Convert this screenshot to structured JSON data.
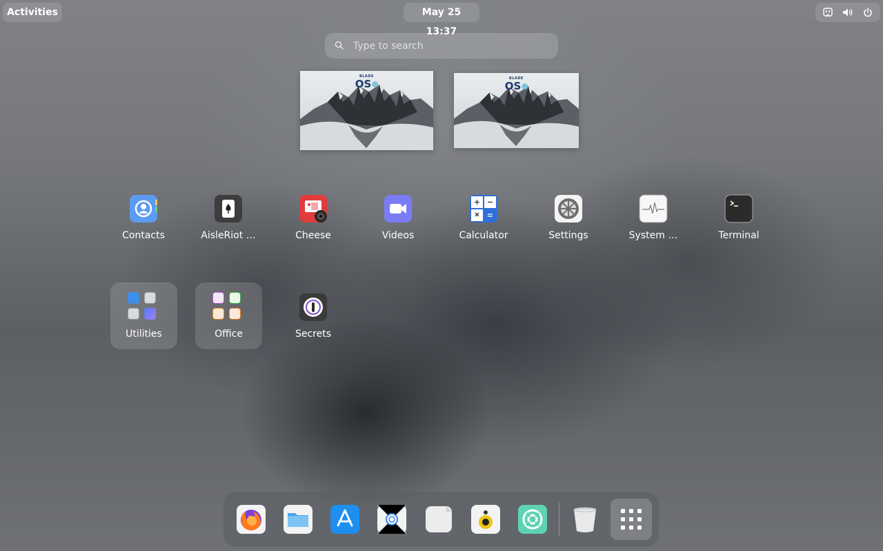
{
  "topbar": {
    "activities_label": "Activities",
    "date": "May 25",
    "time": "13:37",
    "tray_icons": [
      "accessibility-icon",
      "volume-icon",
      "power-icon"
    ]
  },
  "search": {
    "placeholder": "Type to search"
  },
  "workspaces": [
    {
      "logo_small": "BLADE",
      "logo_big": "OS"
    },
    {
      "logo_small": "BLADE",
      "logo_big": "OS"
    }
  ],
  "apps": [
    {
      "label": "Contacts",
      "icon": "contacts-icon"
    },
    {
      "label": "AisleRiot …",
      "icon": "aisleriot-icon"
    },
    {
      "label": "Cheese",
      "icon": "cheese-icon"
    },
    {
      "label": "Videos",
      "icon": "videos-icon"
    },
    {
      "label": "Calculator",
      "icon": "calculator-icon"
    },
    {
      "label": "Settings",
      "icon": "settings-icon"
    },
    {
      "label": "System …",
      "icon": "system-monitor-icon"
    },
    {
      "label": "Terminal",
      "icon": "terminal-icon"
    },
    {
      "label": "Utilities",
      "icon": "utilities-folder-icon"
    },
    {
      "label": "Office",
      "icon": "office-folder-icon"
    },
    {
      "label": "Secrets",
      "icon": "secrets-icon"
    }
  ],
  "dock": {
    "items": [
      "firefox-icon",
      "files-icon",
      "app-store-icon",
      "browser-icon",
      "text-editor-icon",
      "rhythmbox-icon",
      "help-icon",
      "trash-icon",
      "show-apps-icon"
    ]
  },
  "colors": {
    "accent": "#3584e4",
    "contacts": "#5b9cf2",
    "cheese": "#e23b3b",
    "videos": "#7a7cf6",
    "calculator": "#2f6fd8",
    "help": "#5ed3b3"
  }
}
